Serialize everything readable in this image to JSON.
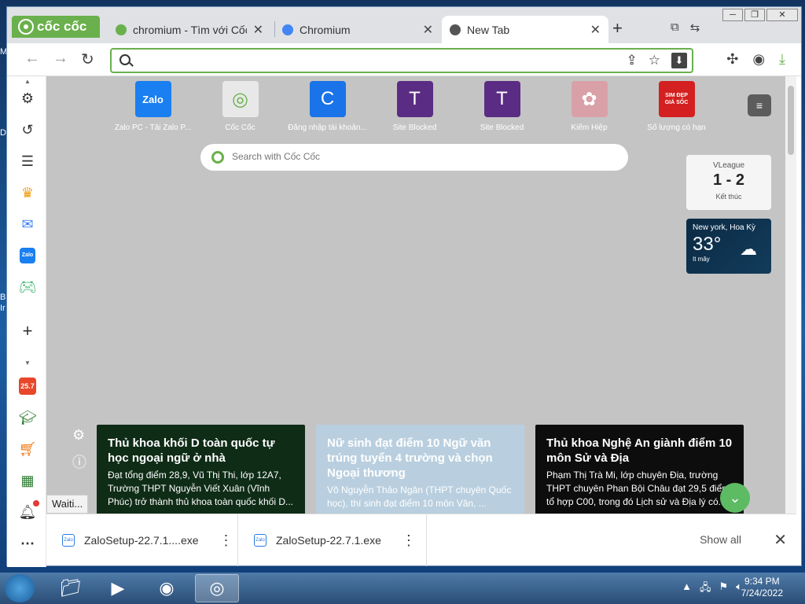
{
  "desktop": {
    "left_letters": [
      "M",
      "D",
      "B",
      "Ir"
    ]
  },
  "browser": {
    "brand": "cốc cốc",
    "tabs": [
      {
        "title": "chromium - Tìm với Cốc Cốc",
        "favicon_color": "#6ab04c"
      },
      {
        "title": "Chromium",
        "favicon_color": "#4285f4"
      },
      {
        "title": "New Tab",
        "favicon_color": "#555555"
      }
    ],
    "window_controls": [
      "─",
      "❐",
      "✕"
    ],
    "omnibox": {
      "value": "",
      "placeholder": ""
    }
  },
  "sidebar": {
    "items": [
      "gear",
      "history",
      "list",
      "crown",
      "messenger",
      "zalo",
      "game",
      "add"
    ],
    "bottom_items": [
      "shopee-25.7",
      "grad-cap",
      "shop",
      "spreadsheet",
      "bell",
      "more"
    ],
    "shopee_label": "25.7"
  },
  "newtab": {
    "shortcuts": [
      {
        "label": "Zalo PC - Tải Zalo P...",
        "glyph": "Zalo",
        "color": "#1a7ff0"
      },
      {
        "label": "Cốc Cốc",
        "glyph": "◎",
        "color": "#e8e8e8"
      },
      {
        "label": "Đăng nhập tài khoản...",
        "glyph": "C",
        "color": "#1a73e8"
      },
      {
        "label": "Site Blocked",
        "glyph": "T",
        "color": "#5b2c83"
      },
      {
        "label": "Site Blocked",
        "glyph": "T",
        "color": "#5b2c83"
      },
      {
        "label": "Kiếm Hiệp",
        "glyph": "✿",
        "color": "#d9a0a8"
      },
      {
        "label": "Số lượng có hạn",
        "glyph": "SIM ĐẸP GIÁ SỐC",
        "color": "#d42020"
      }
    ],
    "search_placeholder": "Search with Cốc Cốc",
    "score_widget": {
      "league": "VLeague",
      "score": "1 - 2",
      "status": "Kết thúc"
    },
    "weather_widget": {
      "location": "New york, Hoa Kỳ",
      "temperature": "33°",
      "condition": "It mây"
    },
    "news": [
      {
        "headline": "Thủ khoa khối D toàn quốc tự học ngoại ngữ ở nhà",
        "body": "Đạt tổng điểm 28,9, Vũ Thị Thi, lớp 12A7, Trường THPT Nguyễn Viết Xuân (Vĩnh Phúc) trở thành thủ khoa toàn quốc khối D..."
      },
      {
        "headline": "Nữ sinh đạt điểm 10 Ngữ văn trúng tuyển 4 trường và chọn Ngoại thương",
        "body": "Võ Nguyễn Thảo Ngân (THPT chuyên Quốc học), thí sinh đạt điểm 10 môn Văn, ..."
      },
      {
        "headline": "Thủ khoa Nghệ An giành điểm 10 môn Sử và Địa",
        "body": "Phạm Thị Trà Mi, lớp chuyên Địa, trường THPT chuyên Phan Bội Châu đạt 29,5 điểm tổ hợp C00, trong đó Lịch sử và Địa lý có..."
      }
    ]
  },
  "downloads": {
    "waiting_label": "Waiti...",
    "items": [
      {
        "name": "ZaloSetup-22.7.1....exe"
      },
      {
        "name": "ZaloSetup-22.7.1.exe"
      }
    ],
    "show_all": "Show all"
  },
  "taskbar": {
    "time": "9:34 PM",
    "date": "7/24/2022"
  }
}
